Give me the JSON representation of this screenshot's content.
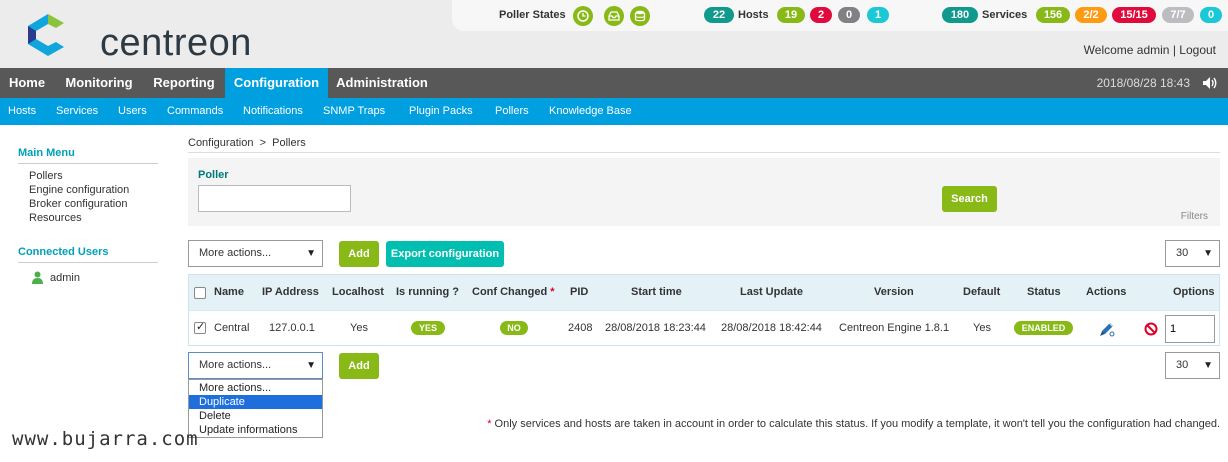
{
  "brand": {
    "logo_text": "centreon"
  },
  "status": {
    "poller_states_label": "Poller States",
    "hosts_label": "Hosts",
    "services_label": "Services",
    "hosts": [
      {
        "value": "22",
        "color": "#11998e"
      },
      {
        "value": "19",
        "color": "#88b917"
      },
      {
        "value": "2",
        "color": "#e00b3d"
      },
      {
        "value": "0",
        "color": "#818185"
      },
      {
        "value": "1",
        "color": "#1bc8d6"
      }
    ],
    "services": [
      {
        "value": "180",
        "color": "#11998e"
      },
      {
        "value": "156",
        "color": "#88b917"
      },
      {
        "value": "2/2",
        "color": "#ff9a13"
      },
      {
        "value": "15/15",
        "color": "#e00b3d"
      },
      {
        "value": "7/7",
        "color": "#bcbdc0"
      },
      {
        "value": "0",
        "color": "#1bc8d6"
      }
    ]
  },
  "user": {
    "welcome": "Welcome admin",
    "separator": "|",
    "logout": "Logout"
  },
  "nav": {
    "items": [
      "Home",
      "Monitoring",
      "Reporting",
      "Configuration",
      "Administration"
    ],
    "datetime": "2018/08/28 18:43"
  },
  "subnav": {
    "items": [
      "Hosts",
      "Services",
      "Users",
      "Commands",
      "Notifications",
      "SNMP Traps",
      "Plugin Packs",
      "Pollers",
      "Knowledge Base"
    ]
  },
  "sidebar": {
    "main_menu_title": "Main Menu",
    "items": [
      "Pollers",
      "Engine configuration",
      "Broker configuration",
      "Resources"
    ],
    "connected_title": "Connected Users",
    "users": [
      "admin"
    ]
  },
  "breadcrumb": {
    "root": "Configuration",
    "sep": ">",
    "current": "Pollers"
  },
  "filter": {
    "label": "Poller",
    "value": "",
    "search": "Search",
    "filters_link": "Filters"
  },
  "actions": {
    "more_actions": "More actions...",
    "add": "Add",
    "export": "Export configuration",
    "page_size": "30"
  },
  "table": {
    "headers": {
      "name": "Name",
      "ip": "IP Address",
      "localhost": "Localhost",
      "running": "Is running ?",
      "conf_changed": "Conf Changed",
      "required_mark": "*",
      "pid": "PID",
      "start": "Start time",
      "update": "Last Update",
      "version": "Version",
      "default": "Default",
      "status": "Status",
      "actions": "Actions",
      "options": "Options"
    },
    "rows": [
      {
        "name": "Central",
        "ip": "127.0.0.1",
        "localhost": "Yes",
        "running": "YES",
        "conf_changed": "NO",
        "pid": "2408",
        "start": "28/08/2018 18:23:44",
        "update": "28/08/2018 18:42:44",
        "version": "Centreon Engine 1.8.1",
        "default": "Yes",
        "status": "ENABLED",
        "options_value": "1"
      }
    ]
  },
  "dropdown": {
    "options": [
      "More actions...",
      "Duplicate",
      "Delete",
      "Update informations"
    ],
    "selected": 1
  },
  "footnote": {
    "mark": "*",
    "text": "Only services and hosts are taken in account in order to calculate this status. If you modify a template, it won't tell you the configuration had changed."
  },
  "watermark": "www.bujarra.com"
}
